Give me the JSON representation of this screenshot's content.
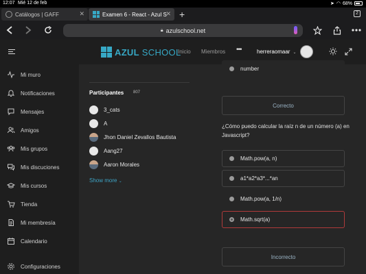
{
  "status": {
    "time": "12:07",
    "date": "Mié 12 de feb",
    "battery": "68%"
  },
  "tabs": [
    {
      "label": "Catálogos | GAFF",
      "active": false
    },
    {
      "label": "Examen 6 - React - Azul S",
      "active": true
    }
  ],
  "tab_count": "2",
  "url": "azulschool.net",
  "sidebar": {
    "items": [
      {
        "label": "Mi muro",
        "icon": "activity-icon"
      },
      {
        "label": "Notificaciones",
        "icon": "bell-icon"
      },
      {
        "label": "Mensajes",
        "icon": "message-icon"
      },
      {
        "label": "Amigos",
        "icon": "users-icon"
      },
      {
        "label": "Mis grupos",
        "icon": "group-icon"
      },
      {
        "label": "Mis discuciones",
        "icon": "discussion-icon"
      },
      {
        "label": "Mis cursos",
        "icon": "graduation-cap-icon"
      },
      {
        "label": "Tienda",
        "icon": "cart-icon"
      },
      {
        "label": "Mi membresía",
        "icon": "document-icon"
      },
      {
        "label": "Calendario",
        "icon": "calendar-icon"
      },
      {
        "label": "Configuraciones",
        "icon": "gear-icon"
      }
    ]
  },
  "header": {
    "logo_azul": "AZUL",
    "logo_school": "SCHOOL",
    "links": [
      "Inicio",
      "Miembros"
    ],
    "more": "•••",
    "username": "herreraomaar"
  },
  "participants": {
    "title": "Participantes",
    "count": "807",
    "list": [
      "3_cats",
      "A",
      "Jhon Daniel Zevallos Bautista",
      "Aang27",
      "Aaron Morales"
    ],
    "show_more": "Show more"
  },
  "quiz": {
    "prev_option": "number",
    "correct_label": "Correcto",
    "question": "¿Cómo puedo calcular la raíz n de un número (a) en Javascript?",
    "options": [
      "Math.pow(a, n)",
      "a1*a2*a3*...*an",
      "Math.pow(a, 1/n)",
      "Math.sqrt(a)"
    ],
    "selected_index": 3,
    "incorrect_label": "Incorrecto"
  },
  "colors": {
    "accent": "#37a9c6",
    "wrong": "#b13b3b",
    "link": "#3ea5c7"
  }
}
